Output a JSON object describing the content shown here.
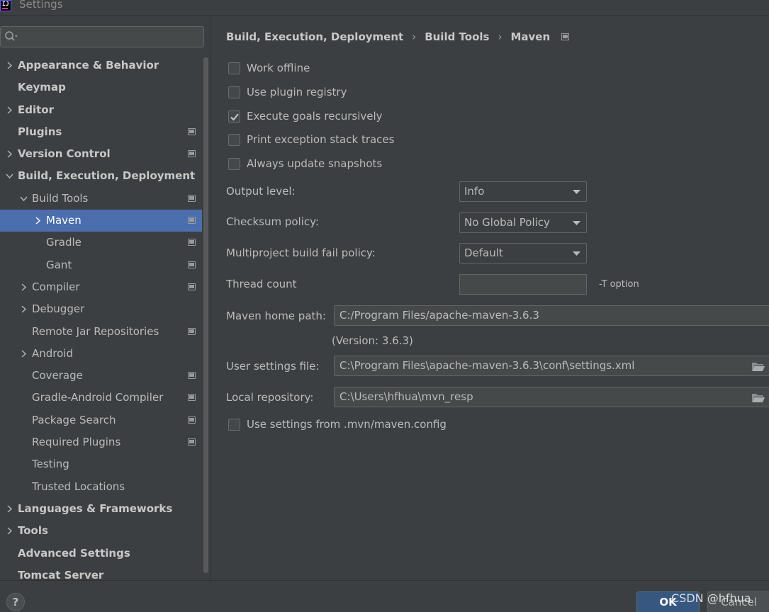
{
  "window": {
    "title": "Settings"
  },
  "search": {
    "placeholder": "",
    "value": ""
  },
  "tree": {
    "items": [
      {
        "label": "Appearance & Behavior",
        "expandable": true,
        "bold": true
      },
      {
        "label": "Keymap",
        "bold": true
      },
      {
        "label": "Editor",
        "expandable": true,
        "bold": true
      },
      {
        "label": "Plugins",
        "bold": true,
        "project": true
      },
      {
        "label": "Version Control",
        "expandable": true,
        "bold": true,
        "project": true
      },
      {
        "label": "Build, Execution, Deployment",
        "expandable": true,
        "expanded": true,
        "bold": true
      },
      {
        "label": "Build Tools",
        "expandable": true,
        "expanded": true,
        "project": true
      },
      {
        "label": "Maven",
        "expandable": true,
        "selected": true,
        "project": true
      },
      {
        "label": "Gradle",
        "project": true
      },
      {
        "label": "Gant",
        "project": true
      },
      {
        "label": "Compiler",
        "expandable": true,
        "project": true
      },
      {
        "label": "Debugger",
        "expandable": true
      },
      {
        "label": "Remote Jar Repositories",
        "project": true
      },
      {
        "label": "Android",
        "expandable": true
      },
      {
        "label": "Coverage",
        "project": true
      },
      {
        "label": "Gradle-Android Compiler",
        "project": true
      },
      {
        "label": "Package Search",
        "project": true
      },
      {
        "label": "Required Plugins",
        "project": true
      },
      {
        "label": "Testing"
      },
      {
        "label": "Trusted Locations"
      },
      {
        "label": "Languages & Frameworks",
        "expandable": true,
        "bold": true
      },
      {
        "label": "Tools",
        "expandable": true,
        "bold": true
      },
      {
        "label": "Advanced Settings",
        "bold": true
      },
      {
        "label": "Tomcat Server",
        "bold": true
      }
    ]
  },
  "breadcrumb": {
    "items": [
      "Build, Execution, Deployment",
      "Build Tools",
      "Maven"
    ],
    "separator": "›"
  },
  "maven": {
    "checkboxes": {
      "work_offline": {
        "label": "Work offline",
        "checked": false
      },
      "use_plugin_registry": {
        "label": "Use plugin registry",
        "checked": false
      },
      "execute_goals_recursively": {
        "label": "Execute goals recursively",
        "checked": true
      },
      "print_exception_stack_traces": {
        "label": "Print exception stack traces",
        "checked": false
      },
      "always_update_snapshots": {
        "label": "Always update snapshots",
        "checked": false
      },
      "use_mvn_config": {
        "label": "Use settings from .mvn/maven.config",
        "checked": false
      }
    },
    "output_level": {
      "label": "Output level:",
      "value": "Info"
    },
    "checksum_policy": {
      "label": "Checksum policy:",
      "value": "No Global Policy"
    },
    "multiproject_fail_policy": {
      "label": "Multiproject build fail policy:",
      "value": "Default"
    },
    "thread_count": {
      "label": "Thread count",
      "value": "",
      "hint": "-T option"
    },
    "home_path": {
      "label": "Maven home path:",
      "value": "C:/Program Files/apache-maven-3.6.3",
      "version": "(Version: 3.6.3)"
    },
    "user_settings": {
      "label": "User settings file:",
      "value": "C:\\Program Files\\apache-maven-3.6.3\\conf\\settings.xml"
    },
    "local_repository": {
      "label": "Local repository:",
      "value": "C:\\Users\\hfhua\\mvn_resp"
    }
  },
  "footer": {
    "help_label": "?",
    "ok_label": "OK",
    "cancel_label": "Cancel",
    "watermark": "CSDN @hfhua"
  },
  "colors": {
    "background": "#3c3f41",
    "selection": "#4b6eaf",
    "primary_button": "#365880",
    "text": "#bbbbbb"
  },
  "icons": {
    "app": "intellij-logo-icon",
    "search": "search-icon",
    "expand": "chevron-right-icon",
    "collapse": "chevron-down-icon",
    "project": "project-scope-icon",
    "dropdown": "dropdown-arrow-icon",
    "folder": "folder-open-icon",
    "checkmark": "checkmark-icon"
  }
}
